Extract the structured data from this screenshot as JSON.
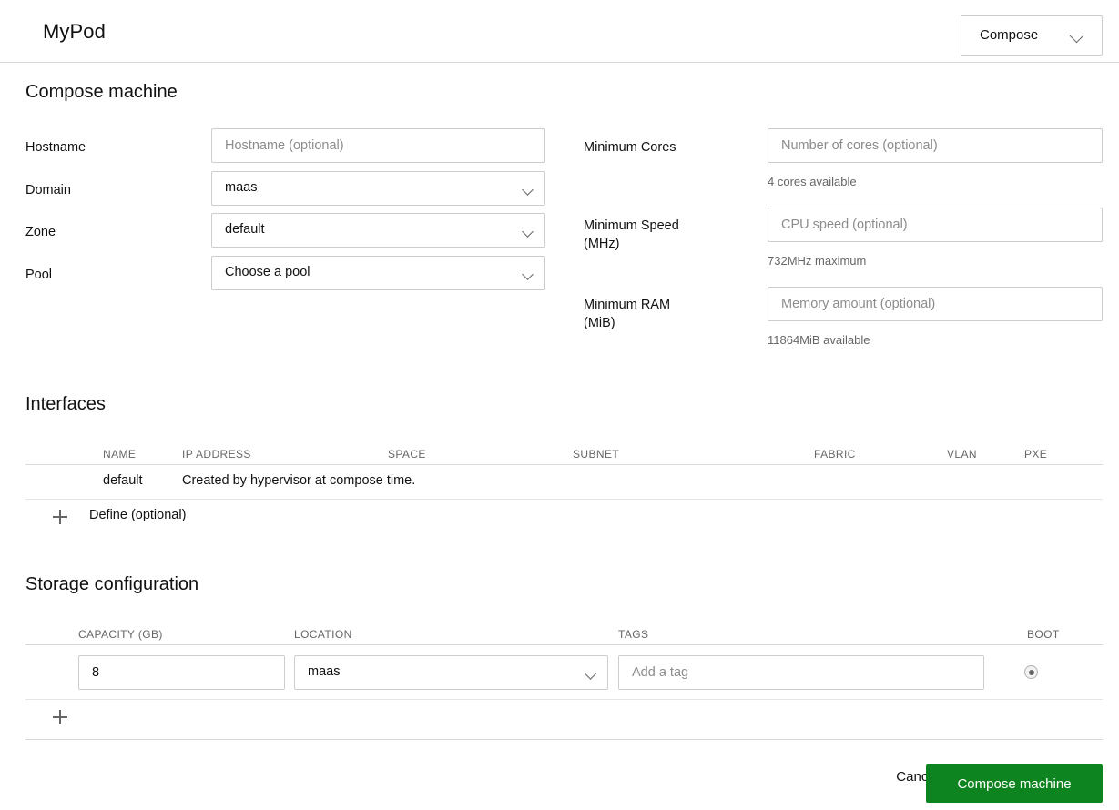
{
  "header": {
    "title": "MyPod",
    "action_select": {
      "label": "Compose",
      "icon": "chevron-down-icon"
    }
  },
  "sections": {
    "compose_machine": {
      "title": "Compose machine",
      "left_fields": [
        {
          "label": "Hostname",
          "type": "text",
          "value": "",
          "placeholder": "Hostname (optional)"
        },
        {
          "label": "Domain",
          "type": "select",
          "value": "maas"
        },
        {
          "label": "Zone",
          "type": "select",
          "value": "default"
        },
        {
          "label": "Pool",
          "type": "select",
          "value": "Choose a pool"
        }
      ],
      "right_fields": [
        {
          "label": "Minimum Cores",
          "type": "text",
          "value": "",
          "placeholder": "Number of cores (optional)",
          "helper": "4 cores available"
        },
        {
          "label": "Minimum Speed (MHz)",
          "label_line1": "Minimum Speed",
          "label_line2": "(MHz)",
          "type": "text",
          "value": "",
          "placeholder": "CPU speed (optional)",
          "helper": "732MHz maximum"
        },
        {
          "label": "Minimum RAM (MiB)",
          "label_line1": "Minimum RAM",
          "label_line2": "(MiB)",
          "type": "text",
          "value": "",
          "placeholder": "Memory amount (optional)",
          "helper": "11864MiB available"
        }
      ]
    },
    "interfaces": {
      "title": "Interfaces",
      "columns": [
        "NAME",
        "IP ADDRESS",
        "SPACE",
        "SUBNET",
        "FABRIC",
        "VLAN",
        "PXE"
      ],
      "rows": [
        {
          "name": "default",
          "ip_address": "Created by hypervisor at compose time.",
          "space": "",
          "subnet": "",
          "fabric": "",
          "vlan": "",
          "pxe": ""
        }
      ],
      "add_row": {
        "icon": "plus-icon",
        "label": "Define (optional)"
      }
    },
    "storage": {
      "title": "Storage configuration",
      "columns": [
        "CAPACITY (GB)",
        "LOCATION",
        "TAGS",
        "BOOT"
      ],
      "rows": [
        {
          "capacity": "8",
          "location": "maas",
          "tags_value": "",
          "tags_placeholder": "Add a tag",
          "boot_selected": true
        }
      ],
      "add_row": {
        "icon": "plus-icon",
        "label": ""
      }
    }
  },
  "footer": {
    "cancel_label": "Cancel",
    "submit_label": "Compose machine"
  },
  "colors": {
    "accent_green": "#0e8420",
    "border": "#cdcdcd",
    "divider": "#d9d9d9",
    "muted_text": "#666666",
    "placeholder": "#8c8c8c"
  }
}
